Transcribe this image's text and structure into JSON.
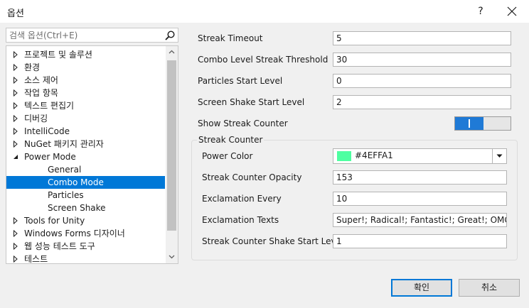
{
  "window": {
    "title": "옵션",
    "help_label": "?"
  },
  "search": {
    "placeholder": "검색 옵션(Ctrl+E)"
  },
  "tree": [
    {
      "label": "프로젝트 및 솔루션",
      "arrow": "right",
      "level": 0,
      "selected": false
    },
    {
      "label": "환경",
      "arrow": "right",
      "level": 0,
      "selected": false
    },
    {
      "label": "소스 제어",
      "arrow": "right",
      "level": 0,
      "selected": false
    },
    {
      "label": "작업 항목",
      "arrow": "right",
      "level": 0,
      "selected": false
    },
    {
      "label": "텍스트 편집기",
      "arrow": "right",
      "level": 0,
      "selected": false
    },
    {
      "label": "디버깅",
      "arrow": "right",
      "level": 0,
      "selected": false
    },
    {
      "label": "IntelliCode",
      "arrow": "right",
      "level": 0,
      "selected": false
    },
    {
      "label": "NuGet 패키지 관리자",
      "arrow": "right",
      "level": 0,
      "selected": false
    },
    {
      "label": "Power Mode",
      "arrow": "down",
      "level": 0,
      "selected": false
    },
    {
      "label": "General",
      "arrow": "none",
      "level": 1,
      "selected": false
    },
    {
      "label": "Combo Mode",
      "arrow": "none",
      "level": 1,
      "selected": true
    },
    {
      "label": "Particles",
      "arrow": "none",
      "level": 1,
      "selected": false
    },
    {
      "label": "Screen Shake",
      "arrow": "none",
      "level": 1,
      "selected": false
    },
    {
      "label": "Tools for Unity",
      "arrow": "right",
      "level": 0,
      "selected": false
    },
    {
      "label": "Windows Forms 디자이너",
      "arrow": "right",
      "level": 0,
      "selected": false
    },
    {
      "label": "웹 성능 테스트 도구",
      "arrow": "right",
      "level": 0,
      "selected": false
    },
    {
      "label": "테스트",
      "arrow": "right",
      "level": 0,
      "selected": false
    }
  ],
  "settings": {
    "streak_timeout": {
      "label": "Streak Timeout",
      "value": "5"
    },
    "combo_threshold": {
      "label": "Combo Level Streak Threshold",
      "value": "30"
    },
    "particles_start": {
      "label": "Particles Start Level",
      "value": "0"
    },
    "shake_start": {
      "label": "Screen Shake Start Level",
      "value": "2"
    },
    "show_streak": {
      "label": "Show Streak Counter",
      "on": true
    }
  },
  "streak_group": {
    "title": "Streak Counter",
    "power_color": {
      "label": "Power Color",
      "value": "#4EFFA1",
      "swatch": "#4effa1"
    },
    "opacity": {
      "label": "Streak Counter Opacity",
      "value": "153"
    },
    "exclamation_every": {
      "label": "Exclamation Every",
      "value": "10"
    },
    "exclamation_texts": {
      "label": "Exclamation Texts",
      "value": "Super!; Radical!; Fantastic!; Great!; OMG; Whoah!"
    },
    "shake_start": {
      "label": "Streak Counter Shake Start Level",
      "value": "1"
    }
  },
  "buttons": {
    "ok": "확인",
    "cancel": "취소"
  },
  "colors": {
    "accent": "#0078d7",
    "toggle_on": "#1f7ad6"
  }
}
